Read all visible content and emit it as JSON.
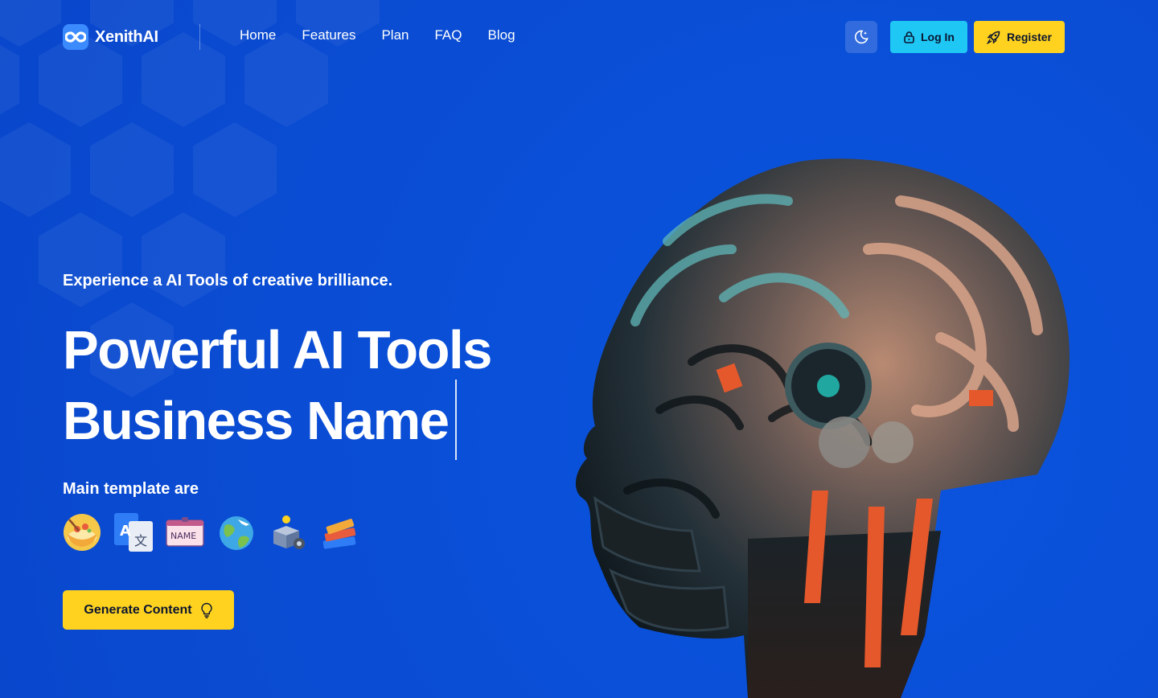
{
  "brand": {
    "name": "XenithAI",
    "logo_icon": "infinity-icon",
    "accent": "#0a4fd6"
  },
  "nav": {
    "items": [
      {
        "label": "Home"
      },
      {
        "label": "Features"
      },
      {
        "label": "Plan"
      },
      {
        "label": "FAQ"
      },
      {
        "label": "Blog"
      }
    ]
  },
  "header_actions": {
    "theme_toggle_icon": "moon-sparkle-icon",
    "login_label": "Log In",
    "login_icon": "lock-icon",
    "register_label": "Register",
    "register_icon": "rocket-icon"
  },
  "hero": {
    "eyebrow": "Experience a AI Tools of creative brilliance.",
    "title_line1": "Powerful AI Tools",
    "title_line2": "Business Name",
    "templates_label": "Main template are",
    "template_icons": [
      "food-bowl-icon",
      "translate-icon",
      "name-tag-icon",
      "globe-travel-icon",
      "idea-box-icon",
      "books-icon"
    ],
    "cta_label": "Generate Content",
    "cta_icon": "lightbulb-icon"
  },
  "colors": {
    "background": "#0a4fd6",
    "login_button": "#1ec7f4",
    "register_button": "#ffd21f",
    "cta_button": "#ffd21f"
  }
}
